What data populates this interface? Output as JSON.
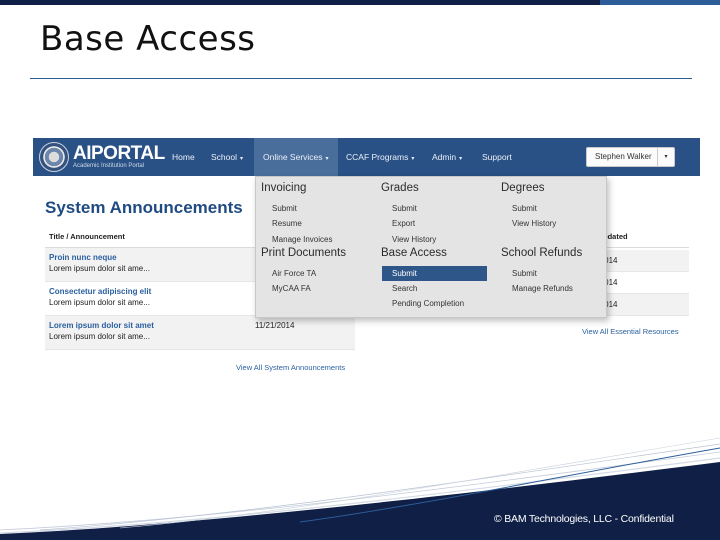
{
  "slide": {
    "title": "Base Access",
    "footer": "© BAM Technologies, LLC - Confidential"
  },
  "portal": {
    "logo_main": "AIPORTAL",
    "logo_sub": "Academic Institution Portal",
    "nav": [
      {
        "label": "Home"
      },
      {
        "label": "School",
        "caret": "▾"
      },
      {
        "label": "Online Services",
        "caret": "▾"
      },
      {
        "label": "CCAF Programs",
        "caret": "▾"
      },
      {
        "label": "Admin",
        "caret": "▾"
      },
      {
        "label": "Support"
      }
    ],
    "user": "Stephen Walker",
    "user_caret": "▾",
    "announcements_title": "System Announcements",
    "table_header": "Title / Announcement",
    "rows": [
      {
        "title": "Proin nunc neque",
        "desc": "Lorem ipsum dolor sit ame..."
      },
      {
        "title": "Consectetur adipiscing elit",
        "desc": "Lorem ipsum dolor sit ame..."
      },
      {
        "title": "Lorem ipsum dolor sit amet",
        "desc": "Lorem ipsum dolor sit ame...",
        "date": "11/21/2014"
      }
    ],
    "view_all_announcements": "View All System Announcements",
    "updated_header": "t Updated",
    "updated_dates": [
      "1/2014",
      "1/2014",
      "1/2014"
    ],
    "view_all_resources": "View All Essential Resources",
    "menu": {
      "invoicing": {
        "title": "Invoicing",
        "links": [
          "Submit",
          "Resume",
          "Manage Invoices"
        ]
      },
      "grades": {
        "title": "Grades",
        "links": [
          "Submit",
          "Export",
          "View History"
        ]
      },
      "degrees": {
        "title": "Degrees",
        "links": [
          "Submit",
          "View History"
        ]
      },
      "print_documents": {
        "title": "Print Documents",
        "links": [
          "Air Force TA",
          "MyCAA FA"
        ]
      },
      "base_access": {
        "title": "Base Access",
        "links": [
          "Submit",
          "Search",
          "Pending Completion"
        ]
      },
      "school_refunds": {
        "title": "School Refunds",
        "links": [
          "Submit",
          "Manage Refunds"
        ]
      }
    }
  },
  "colors": {
    "navbar": "#2a5185",
    "nav_active": "#4a6e9b",
    "selected_item": "#2f5688",
    "link": "#2a5fa0",
    "footer_band": "#0f1f45"
  }
}
